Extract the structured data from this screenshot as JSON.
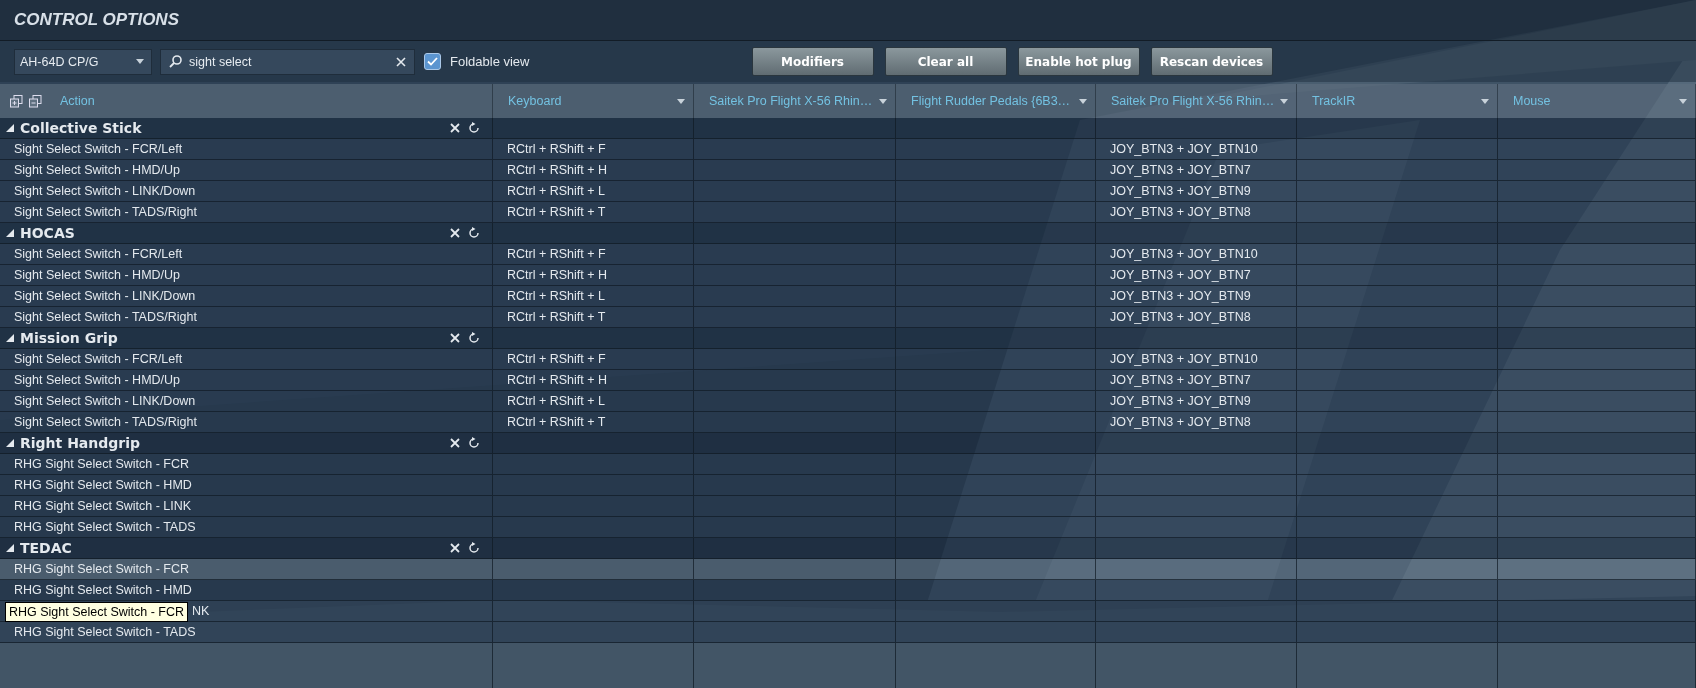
{
  "window": {
    "title": "CONTROL OPTIONS"
  },
  "toolbar": {
    "aircraft": "AH-64D CP/G",
    "search": {
      "value": "sight select"
    },
    "foldable": {
      "label": "Foldable view",
      "checked": true
    },
    "buttons": [
      "Modifiers",
      "Clear all",
      "Enable hot plug",
      "Rescan devices"
    ]
  },
  "table": {
    "action_header": "Action",
    "columns": [
      {
        "label": "Keyboard",
        "kind": "keyboard"
      },
      {
        "label": "Saitek Pro Flight X-56 Rhin…",
        "kind": "device"
      },
      {
        "label": "Flight Rudder Pedals {6B3…",
        "kind": "device"
      },
      {
        "label": "Saitek Pro Flight X-56 Rhin…",
        "kind": "joystick"
      },
      {
        "label": "TrackIR",
        "kind": "device"
      },
      {
        "label": "Mouse",
        "kind": "device"
      }
    ],
    "groups": [
      {
        "name": "Collective Stick",
        "expanded": true,
        "rows": [
          {
            "action": "Sight Select Switch - FCR/Left",
            "keyboard": "RCtrl + RShift + F",
            "joystick": "JOY_BTN3 + JOY_BTN10",
            "selected": false
          },
          {
            "action": "Sight Select Switch - HMD/Up",
            "keyboard": "RCtrl + RShift + H",
            "joystick": "JOY_BTN3 + JOY_BTN7",
            "selected": false
          },
          {
            "action": "Sight Select Switch - LINK/Down",
            "keyboard": "RCtrl + RShift + L",
            "joystick": "JOY_BTN3 + JOY_BTN9",
            "selected": false
          },
          {
            "action": "Sight Select Switch - TADS/Right",
            "keyboard": "RCtrl + RShift + T",
            "joystick": "JOY_BTN3 + JOY_BTN8",
            "selected": false
          }
        ]
      },
      {
        "name": "HOCAS",
        "expanded": true,
        "rows": [
          {
            "action": "Sight Select Switch - FCR/Left",
            "keyboard": "RCtrl + RShift + F",
            "joystick": "JOY_BTN3 + JOY_BTN10",
            "selected": false
          },
          {
            "action": "Sight Select Switch - HMD/Up",
            "keyboard": "RCtrl + RShift + H",
            "joystick": "JOY_BTN3 + JOY_BTN7",
            "selected": false
          },
          {
            "action": "Sight Select Switch - LINK/Down",
            "keyboard": "RCtrl + RShift + L",
            "joystick": "JOY_BTN3 + JOY_BTN9",
            "selected": false
          },
          {
            "action": "Sight Select Switch - TADS/Right",
            "keyboard": "RCtrl + RShift + T",
            "joystick": "JOY_BTN3 + JOY_BTN8",
            "selected": false
          }
        ]
      },
      {
        "name": "Mission Grip",
        "expanded": true,
        "rows": [
          {
            "action": "Sight Select Switch - FCR/Left",
            "keyboard": "RCtrl + RShift + F",
            "joystick": "JOY_BTN3 + JOY_BTN10",
            "selected": false
          },
          {
            "action": "Sight Select Switch - HMD/Up",
            "keyboard": "RCtrl + RShift + H",
            "joystick": "JOY_BTN3 + JOY_BTN7",
            "selected": false
          },
          {
            "action": "Sight Select Switch - LINK/Down",
            "keyboard": "RCtrl + RShift + L",
            "joystick": "JOY_BTN3 + JOY_BTN9",
            "selected": false
          },
          {
            "action": "Sight Select Switch - TADS/Right",
            "keyboard": "RCtrl + RShift + T",
            "joystick": "JOY_BTN3 + JOY_BTN8",
            "selected": false
          }
        ]
      },
      {
        "name": "Right Handgrip",
        "expanded": true,
        "rows": [
          {
            "action": "RHG Sight Select Switch - FCR",
            "selected": false
          },
          {
            "action": "RHG Sight Select Switch - HMD",
            "selected": false
          },
          {
            "action": "RHG Sight Select Switch - LINK",
            "selected": false
          },
          {
            "action": "RHG Sight Select Switch - TADS",
            "selected": false
          }
        ]
      },
      {
        "name": "TEDAC",
        "expanded": true,
        "rows": [
          {
            "action": "RHG Sight Select Switch - FCR",
            "selected": true
          },
          {
            "action": "RHG Sight Select Switch - HMD",
            "selected": false
          },
          {
            "action": "NK",
            "covered": true,
            "selected": false
          },
          {
            "action": "RHG Sight Select Switch - TADS",
            "selected": false
          }
        ]
      }
    ]
  },
  "tooltip": {
    "text": "RHG Sight Select Switch - FCR"
  }
}
